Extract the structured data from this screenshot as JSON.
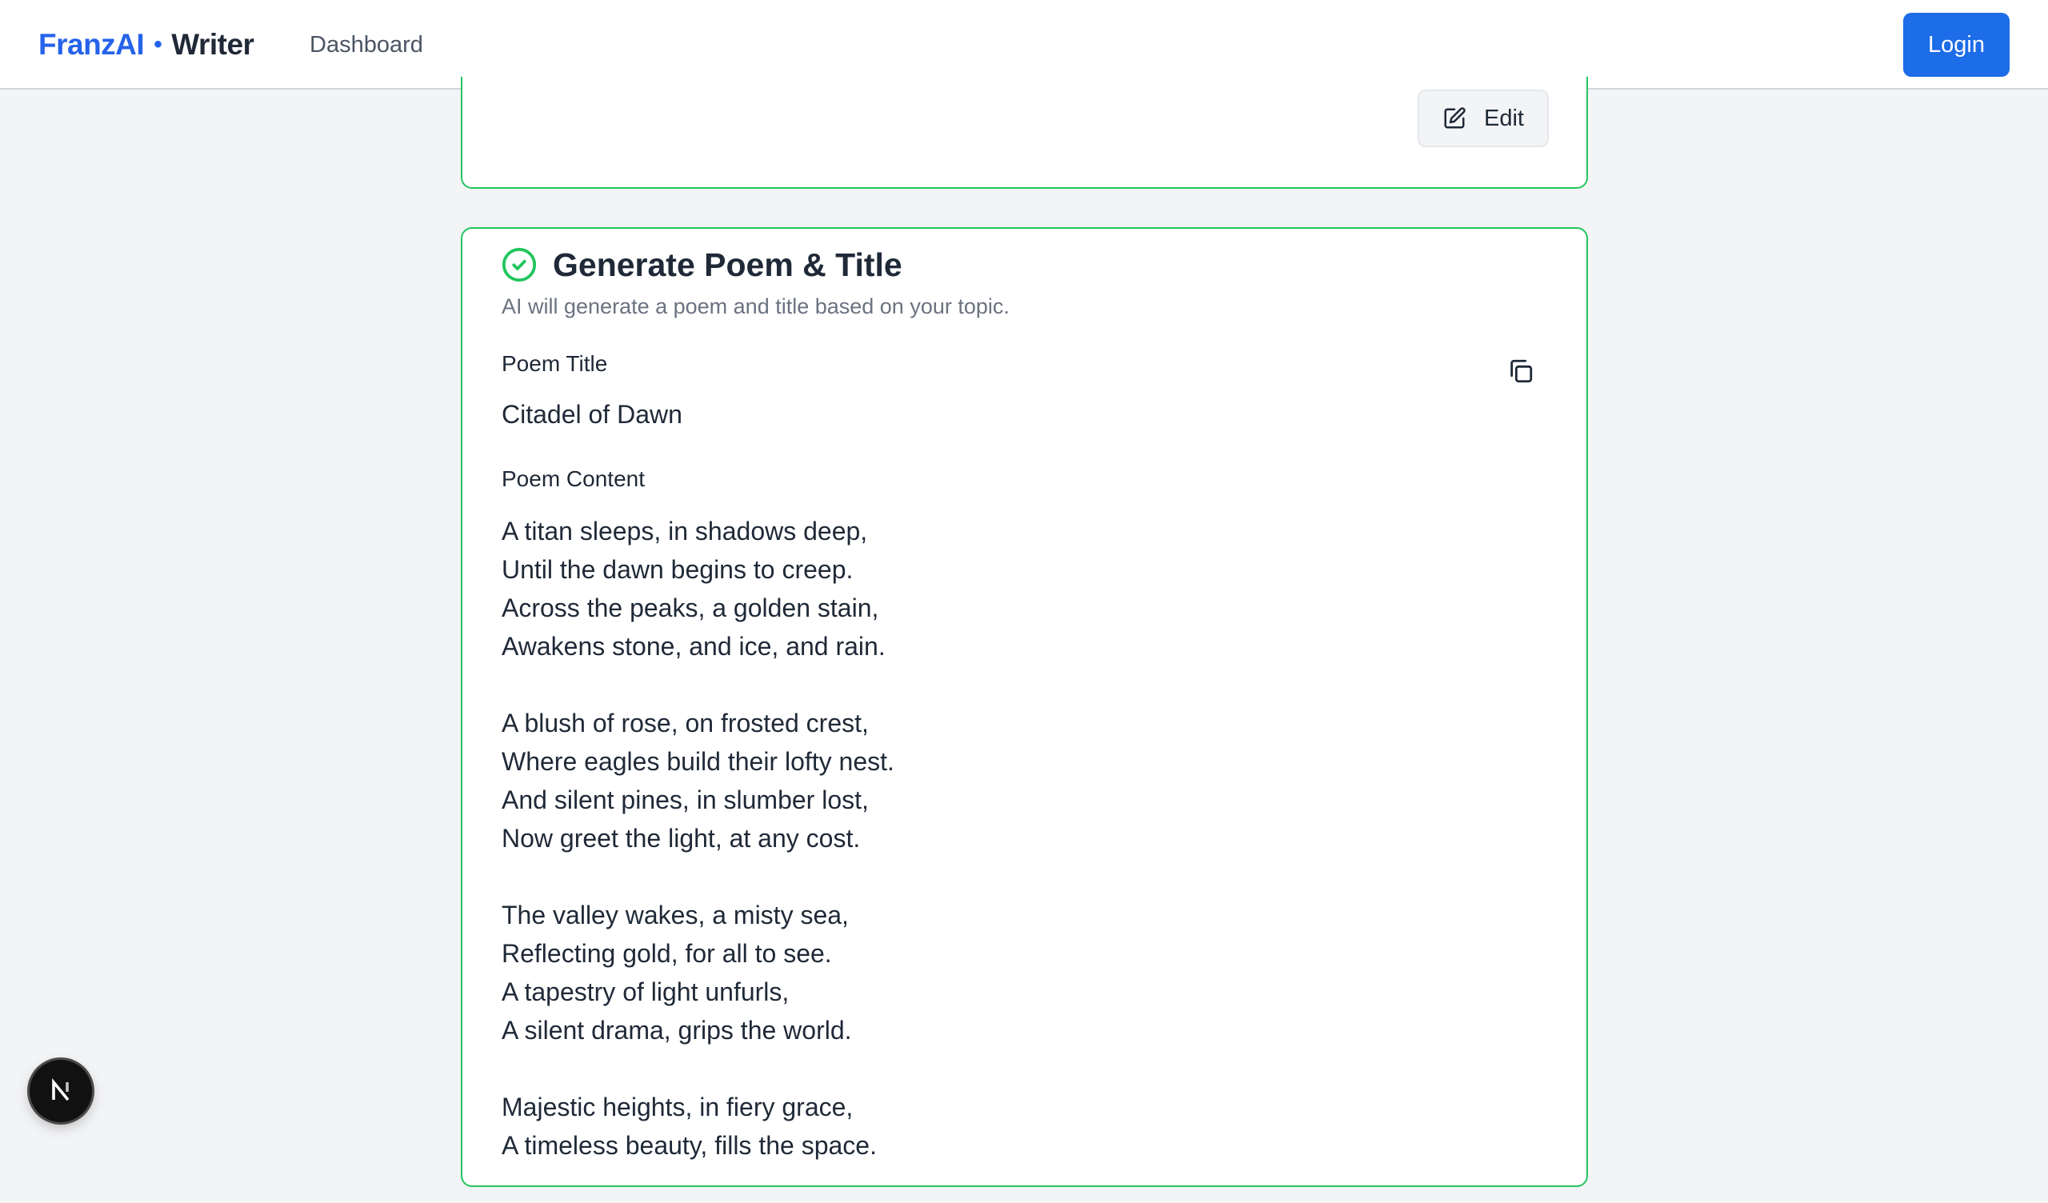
{
  "header": {
    "brand": {
      "part_a": "FranzAI",
      "dot": "•",
      "part_b": "Writer"
    },
    "nav": [
      {
        "label": "Dashboard"
      }
    ],
    "login_label": "Login"
  },
  "previous_step": {
    "edit_label": "Edit",
    "edit_icon": "pencil-square-icon"
  },
  "step": {
    "status_icon": "check-circle-icon",
    "title": "Generate Poem & Title",
    "description": "AI will generate a poem and title based on your topic.",
    "poem_title_label": "Poem Title",
    "poem_title": "Citadel of Dawn",
    "copy_icon": "copy-icon",
    "poem_content_label": "Poem Content",
    "poem_stanzas": [
      [
        "A titan sleeps, in shadows deep,",
        "Until the dawn begins to creep.",
        "Across the peaks, a golden stain,",
        "Awakens stone, and ice, and rain."
      ],
      [
        "A blush of rose, on frosted crest,",
        "Where eagles build their lofty nest.",
        "And silent pines, in slumber lost,",
        "Now greet the light, at any cost."
      ],
      [
        "The valley wakes, a misty sea,",
        "Reflecting gold, for all to see.",
        "A tapestry of light unfurls,",
        "A silent drama, grips the world."
      ],
      [
        "Majestic heights, in fiery grace,",
        "A timeless beauty, fills the space."
      ]
    ]
  },
  "dev_badge": {
    "label": "N"
  },
  "colors": {
    "brand_blue": "#2563eb",
    "login_bg": "#1d6ce8",
    "success_green": "#22c55e",
    "page_bg": "#f3f4f6"
  }
}
